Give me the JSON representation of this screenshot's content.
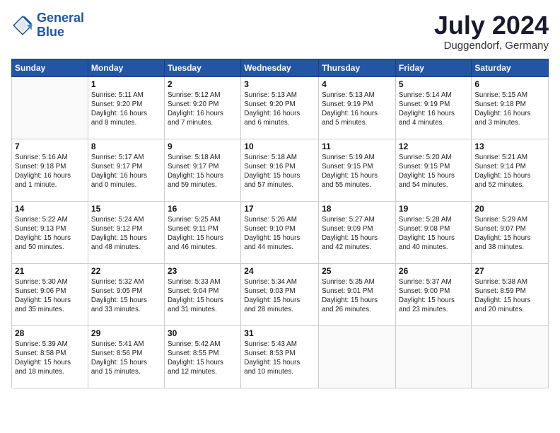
{
  "header": {
    "logo_line1": "General",
    "logo_line2": "Blue",
    "month_title": "July 2024",
    "location": "Duggendorf, Germany"
  },
  "days_of_week": [
    "Sunday",
    "Monday",
    "Tuesday",
    "Wednesday",
    "Thursday",
    "Friday",
    "Saturday"
  ],
  "weeks": [
    [
      {
        "day": "",
        "info": ""
      },
      {
        "day": "1",
        "info": "Sunrise: 5:11 AM\nSunset: 9:20 PM\nDaylight: 16 hours\nand 8 minutes."
      },
      {
        "day": "2",
        "info": "Sunrise: 5:12 AM\nSunset: 9:20 PM\nDaylight: 16 hours\nand 7 minutes."
      },
      {
        "day": "3",
        "info": "Sunrise: 5:13 AM\nSunset: 9:20 PM\nDaylight: 16 hours\nand 6 minutes."
      },
      {
        "day": "4",
        "info": "Sunrise: 5:13 AM\nSunset: 9:19 PM\nDaylight: 16 hours\nand 5 minutes."
      },
      {
        "day": "5",
        "info": "Sunrise: 5:14 AM\nSunset: 9:19 PM\nDaylight: 16 hours\nand 4 minutes."
      },
      {
        "day": "6",
        "info": "Sunrise: 5:15 AM\nSunset: 9:18 PM\nDaylight: 16 hours\nand 3 minutes."
      }
    ],
    [
      {
        "day": "7",
        "info": "Sunrise: 5:16 AM\nSunset: 9:18 PM\nDaylight: 16 hours\nand 1 minute."
      },
      {
        "day": "8",
        "info": "Sunrise: 5:17 AM\nSunset: 9:17 PM\nDaylight: 16 hours\nand 0 minutes."
      },
      {
        "day": "9",
        "info": "Sunrise: 5:18 AM\nSunset: 9:17 PM\nDaylight: 15 hours\nand 59 minutes."
      },
      {
        "day": "10",
        "info": "Sunrise: 5:18 AM\nSunset: 9:16 PM\nDaylight: 15 hours\nand 57 minutes."
      },
      {
        "day": "11",
        "info": "Sunrise: 5:19 AM\nSunset: 9:15 PM\nDaylight: 15 hours\nand 55 minutes."
      },
      {
        "day": "12",
        "info": "Sunrise: 5:20 AM\nSunset: 9:15 PM\nDaylight: 15 hours\nand 54 minutes."
      },
      {
        "day": "13",
        "info": "Sunrise: 5:21 AM\nSunset: 9:14 PM\nDaylight: 15 hours\nand 52 minutes."
      }
    ],
    [
      {
        "day": "14",
        "info": "Sunrise: 5:22 AM\nSunset: 9:13 PM\nDaylight: 15 hours\nand 50 minutes."
      },
      {
        "day": "15",
        "info": "Sunrise: 5:24 AM\nSunset: 9:12 PM\nDaylight: 15 hours\nand 48 minutes."
      },
      {
        "day": "16",
        "info": "Sunrise: 5:25 AM\nSunset: 9:11 PM\nDaylight: 15 hours\nand 46 minutes."
      },
      {
        "day": "17",
        "info": "Sunrise: 5:26 AM\nSunset: 9:10 PM\nDaylight: 15 hours\nand 44 minutes."
      },
      {
        "day": "18",
        "info": "Sunrise: 5:27 AM\nSunset: 9:09 PM\nDaylight: 15 hours\nand 42 minutes."
      },
      {
        "day": "19",
        "info": "Sunrise: 5:28 AM\nSunset: 9:08 PM\nDaylight: 15 hours\nand 40 minutes."
      },
      {
        "day": "20",
        "info": "Sunrise: 5:29 AM\nSunset: 9:07 PM\nDaylight: 15 hours\nand 38 minutes."
      }
    ],
    [
      {
        "day": "21",
        "info": "Sunrise: 5:30 AM\nSunset: 9:06 PM\nDaylight: 15 hours\nand 35 minutes."
      },
      {
        "day": "22",
        "info": "Sunrise: 5:32 AM\nSunset: 9:05 PM\nDaylight: 15 hours\nand 33 minutes."
      },
      {
        "day": "23",
        "info": "Sunrise: 5:33 AM\nSunset: 9:04 PM\nDaylight: 15 hours\nand 31 minutes."
      },
      {
        "day": "24",
        "info": "Sunrise: 5:34 AM\nSunset: 9:03 PM\nDaylight: 15 hours\nand 28 minutes."
      },
      {
        "day": "25",
        "info": "Sunrise: 5:35 AM\nSunset: 9:01 PM\nDaylight: 15 hours\nand 26 minutes."
      },
      {
        "day": "26",
        "info": "Sunrise: 5:37 AM\nSunset: 9:00 PM\nDaylight: 15 hours\nand 23 minutes."
      },
      {
        "day": "27",
        "info": "Sunrise: 5:38 AM\nSunset: 8:59 PM\nDaylight: 15 hours\nand 20 minutes."
      }
    ],
    [
      {
        "day": "28",
        "info": "Sunrise: 5:39 AM\nSunset: 8:58 PM\nDaylight: 15 hours\nand 18 minutes."
      },
      {
        "day": "29",
        "info": "Sunrise: 5:41 AM\nSunset: 8:56 PM\nDaylight: 15 hours\nand 15 minutes."
      },
      {
        "day": "30",
        "info": "Sunrise: 5:42 AM\nSunset: 8:55 PM\nDaylight: 15 hours\nand 12 minutes."
      },
      {
        "day": "31",
        "info": "Sunrise: 5:43 AM\nSunset: 8:53 PM\nDaylight: 15 hours\nand 10 minutes."
      },
      {
        "day": "",
        "info": ""
      },
      {
        "day": "",
        "info": ""
      },
      {
        "day": "",
        "info": ""
      }
    ]
  ]
}
